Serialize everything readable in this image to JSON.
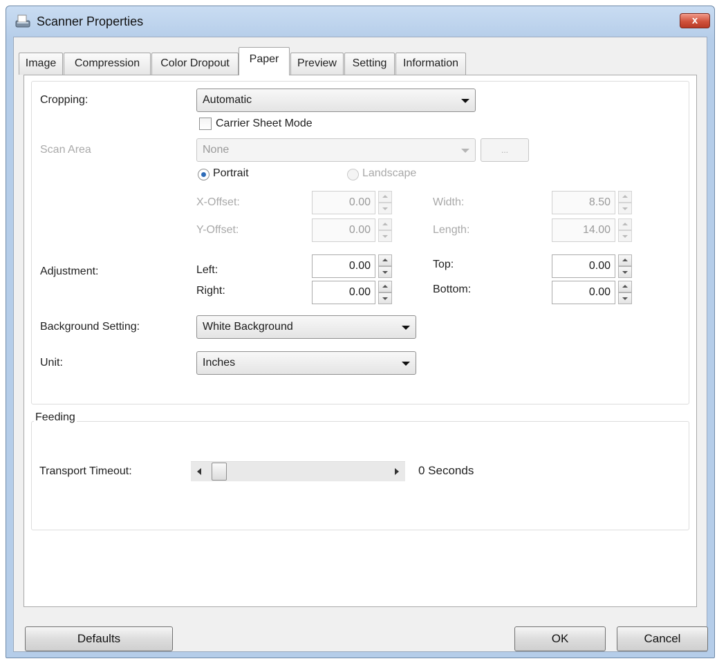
{
  "window": {
    "title": "Scanner Properties",
    "close_label": "x"
  },
  "tabs": [
    {
      "label": "Image"
    },
    {
      "label": "Compression"
    },
    {
      "label": "Color Dropout"
    },
    {
      "label": "Paper",
      "active": true
    },
    {
      "label": "Preview"
    },
    {
      "label": "Setting"
    },
    {
      "label": "Information"
    }
  ],
  "paper": {
    "cropping_label": "Cropping:",
    "cropping_value": "Automatic",
    "carrier_sheet_label": "Carrier Sheet Mode",
    "carrier_sheet_checked": false,
    "scan_area_label": "Scan Area",
    "scan_area_value": "None",
    "scan_area_button": "...",
    "portrait_label": "Portrait",
    "portrait_selected": true,
    "landscape_label": "Landscape",
    "x_offset_label": "X-Offset:",
    "x_offset_value": "0.00",
    "y_offset_label": "Y-Offset:",
    "y_offset_value": "0.00",
    "width_label": "Width:",
    "width_value": "8.50",
    "length_label": "Length:",
    "length_value": "14.00",
    "adjustment_label": "Adjustment:",
    "left_label": "Left:",
    "left_value": "0.00",
    "right_label": "Right:",
    "right_value": "0.00",
    "top_label": "Top:",
    "top_value": "0.00",
    "bottom_label": "Bottom:",
    "bottom_value": "0.00",
    "background_label": "Background Setting:",
    "background_value": "White Background",
    "unit_label": "Unit:",
    "unit_value": "Inches"
  },
  "feeding": {
    "title": "Feeding",
    "transport_label": "Transport Timeout:",
    "timeout_value": "0 Seconds",
    "timeout_fraction": 0
  },
  "buttons": {
    "defaults": "Defaults",
    "ok": "OK",
    "cancel": "Cancel"
  }
}
